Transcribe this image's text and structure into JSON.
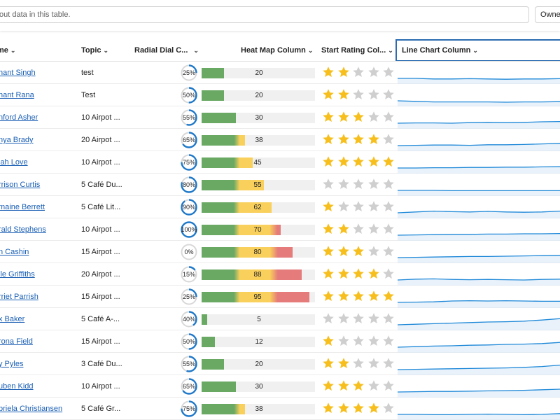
{
  "toolbar": {
    "search_text": "out data in this table.",
    "owner_label": "Owne"
  },
  "columns": [
    {
      "label": "me",
      "key": "name"
    },
    {
      "label": "Topic",
      "key": "topic"
    },
    {
      "label": "Radial Dial C...",
      "key": "dial"
    },
    {
      "label": "Heat Map Column",
      "key": "heat"
    },
    {
      "label": "Start Rating Col...",
      "key": "rating"
    },
    {
      "label": "Line Chart Column",
      "key": "line",
      "selected": true
    }
  ],
  "colors": {
    "link": "#1a5fb4",
    "dial_ring": "#1e78c8",
    "dial_track": "#d8d8d8",
    "heat_green": "#6aa964",
    "heat_yellow": "#f9d05b",
    "heat_red": "#e57b7b",
    "star_on": "#f7bf1e",
    "star_off": "#cfcfcf",
    "line": "#1e88d8",
    "area": "#dbe9f6"
  },
  "rows": [
    {
      "name": "hant Singh",
      "topic": "test",
      "dial": 25,
      "heat": 20,
      "rating": 2,
      "trend": [
        3,
        3,
        2.8,
        2.8,
        2.9,
        2.8,
        2.7,
        2.8,
        2.8,
        2.9
      ]
    },
    {
      "name": "hant Rana",
      "topic": "Test",
      "dial": 50,
      "heat": 20,
      "rating": 2,
      "trend": [
        3,
        2.8,
        2.6,
        2.6,
        2.6,
        2.6,
        2.5,
        2.6,
        2.6,
        2.7
      ]
    },
    {
      "name": "nford Asher",
      "topic": "10 Airpot ...",
      "dial": 55,
      "heat": 30,
      "rating": 3,
      "trend": [
        3,
        3.1,
        3.1,
        3,
        3.2,
        3.3,
        3.2,
        3.3,
        3.5,
        3.6
      ]
    },
    {
      "name": "nya Brady",
      "topic": "20 Airpot ...",
      "dial": 65,
      "heat": 38,
      "rating": 4,
      "trend": [
        3,
        3.1,
        3.2,
        3.2,
        3.1,
        3.3,
        3.3,
        3.4,
        3.6,
        3.8
      ]
    },
    {
      "name": "iah Love",
      "topic": "10 Airpot ...",
      "dial": 75,
      "heat": 45,
      "rating": 5,
      "trend": [
        3,
        3,
        3.1,
        3.1,
        3.2,
        3.2,
        3.3,
        3.3,
        3.4,
        3.5
      ]
    },
    {
      "name": "rrison Curtis",
      "topic": "5 Café Du...",
      "dial": 80,
      "heat": 55,
      "rating": 0,
      "trend": [
        3,
        3,
        3,
        2.9,
        2.9,
        2.9,
        2.9,
        2.9,
        2.9,
        2.9
      ]
    },
    {
      "name": "maine Berrett",
      "topic": "5 Café Lit...",
      "dial": 90,
      "heat": 62,
      "rating": 1,
      "trend": [
        3,
        3.3,
        3.6,
        3.4,
        3.3,
        3.5,
        3.3,
        3.2,
        3.3,
        3.6
      ]
    },
    {
      "name": "rald Stephens",
      "topic": "10 Airpot ...",
      "dial": 100,
      "heat": 70,
      "rating": 2,
      "trend": [
        3,
        3.1,
        3.2,
        3.3,
        3.3,
        3.4,
        3.4,
        3.5,
        3.5,
        3.6
      ]
    },
    {
      "name": "n Cashin",
      "topic": "15 Airpot ...",
      "dial": 0,
      "heat": 80,
      "rating": 3,
      "trend": [
        3,
        3.1,
        3.2,
        3.3,
        3.4,
        3.4,
        3.5,
        3.6,
        3.7,
        3.8
      ]
    },
    {
      "name": "lle Griffiths",
      "topic": "20 Airpot ...",
      "dial": 15,
      "heat": 88,
      "rating": 4,
      "trend": [
        3,
        3.3,
        3.4,
        3.2,
        3.1,
        3.2,
        3.1,
        3,
        3.2,
        3.3
      ]
    },
    {
      "name": "rriet Parrish",
      "topic": "15 Airpot ...",
      "dial": 25,
      "heat": 95,
      "rating": 5,
      "trend": [
        3,
        3.1,
        3.2,
        3.5,
        3.6,
        3.5,
        3.6,
        3.5,
        3.4,
        3.4
      ]
    },
    {
      "name": "x Baker",
      "topic": "5 Café A-...",
      "dial": 40,
      "heat": 5,
      "rating": 0,
      "trend": [
        3,
        3.2,
        3.4,
        3.6,
        3.8,
        4,
        4.1,
        4.3,
        4.7,
        5.2
      ]
    },
    {
      "name": "rona Field",
      "topic": "15 Airpot ...",
      "dial": 50,
      "heat": 12,
      "rating": 1,
      "trend": [
        3,
        3.2,
        3.4,
        3.5,
        3.7,
        3.8,
        4,
        4.1,
        4.3,
        4.7
      ]
    },
    {
      "name": "y Pyles",
      "topic": "3 Café Du...",
      "dial": 55,
      "heat": 20,
      "rating": 2,
      "trend": [
        3,
        3.1,
        3.2,
        3.3,
        3.4,
        3.5,
        3.6,
        3.8,
        4.1,
        4.6
      ]
    },
    {
      "name": "uben Kidd",
      "topic": "10 Airpot ...",
      "dial": 65,
      "heat": 30,
      "rating": 3,
      "trend": [
        3,
        3.1,
        3.2,
        3.2,
        3.3,
        3.4,
        3.5,
        3.6,
        3.8,
        4
      ]
    },
    {
      "name": "briela Christiansen",
      "topic": "5 Café Gr...",
      "dial": 75,
      "heat": 38,
      "rating": 4,
      "trend": [
        3,
        3,
        2.9,
        2.9,
        3,
        3.1,
        3,
        2.9,
        3,
        3.3
      ]
    }
  ]
}
